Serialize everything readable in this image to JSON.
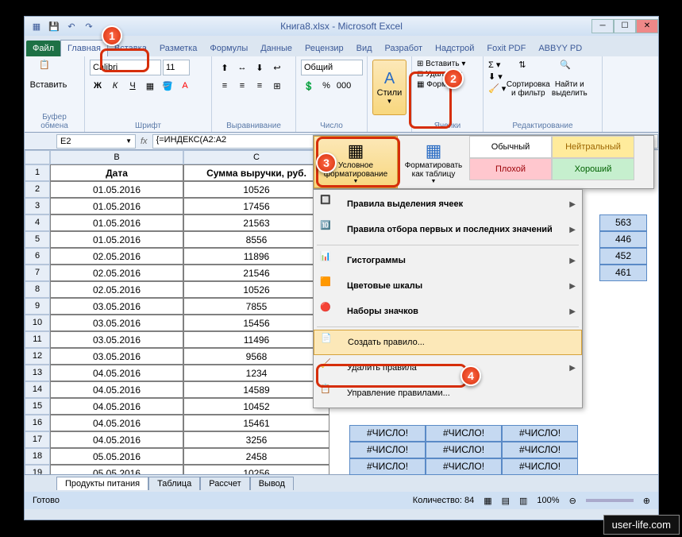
{
  "title": "Книга8.xlsx - Microsoft Excel",
  "tabs": {
    "file": "Файл",
    "home": "Главная",
    "insert": "Вставка",
    "layout": "Разметка",
    "formulas": "Формулы",
    "data": "Данные",
    "review": "Рецензир",
    "view": "Вид",
    "dev": "Разработ",
    "addins": "Надстрой",
    "foxit": "Foxit PDF",
    "abbyy": "ABBYY PD"
  },
  "ribbon": {
    "clipboard": {
      "label": "Буфер обмена",
      "paste": "Вставить"
    },
    "font": {
      "label": "Шрифт",
      "name": "Calibri",
      "size": "11"
    },
    "align": {
      "label": "Выравнивание"
    },
    "number": {
      "label": "Число",
      "format": "Общий"
    },
    "styles": {
      "label": "Стили",
      "cells_label": "Ячейки",
      "insert": "Вставить",
      "delete": "Удалить",
      "format": "Формат"
    },
    "editing": {
      "label": "Редактирование",
      "sort": "Сортировка\nи фильтр",
      "find": "Найти и\nвыделить"
    }
  },
  "namebox": "E2",
  "formula": "{=ИНДЕКС(A2:A2",
  "columns": {
    "b": "B",
    "c": "C"
  },
  "headers": {
    "date": "Дата",
    "revenue": "Сумма выручки, руб."
  },
  "rows": [
    {
      "n": "1"
    },
    {
      "n": "2",
      "d": "01.05.2016",
      "v": "10526"
    },
    {
      "n": "3",
      "d": "01.05.2016",
      "v": "17456"
    },
    {
      "n": "4",
      "d": "01.05.2016",
      "v": "21563"
    },
    {
      "n": "5",
      "d": "01.05.2016",
      "v": "8556"
    },
    {
      "n": "6",
      "d": "02.05.2016",
      "v": "11896"
    },
    {
      "n": "7",
      "d": "02.05.2016",
      "v": "21546"
    },
    {
      "n": "8",
      "d": "02.05.2016",
      "v": "10526"
    },
    {
      "n": "9",
      "d": "03.05.2016",
      "v": "7855"
    },
    {
      "n": "10",
      "d": "03.05.2016",
      "v": "15456"
    },
    {
      "n": "11",
      "d": "03.05.2016",
      "v": "11496"
    },
    {
      "n": "12",
      "d": "03.05.2016",
      "v": "9568"
    },
    {
      "n": "13",
      "d": "04.05.2016",
      "v": "1234"
    },
    {
      "n": "14",
      "d": "04.05.2016",
      "v": "14589"
    },
    {
      "n": "15",
      "d": "04.05.2016",
      "v": "10452"
    },
    {
      "n": "16",
      "d": "04.05.2016",
      "v": "15461"
    },
    {
      "n": "17",
      "d": "04.05.2016",
      "v": "3256"
    },
    {
      "n": "18",
      "d": "05.05.2016",
      "v": "2458"
    },
    {
      "n": "19",
      "d": "05.05.2016",
      "v": "10256"
    }
  ],
  "sheets": {
    "s1": "Продукты питания",
    "s2": "Таблица",
    "s3": "Рассчет",
    "s4": "Вывод"
  },
  "status": {
    "ready": "Готово",
    "count": "Количество: 84",
    "zoom": "100%"
  },
  "gallery": {
    "cf": "Условное\nформатирование",
    "fmt_table": "Форматировать\nкак таблицу",
    "normal": "Обычный",
    "neutral": "Нейтральный",
    "bad": "Плохой",
    "good": "Хороший",
    "vals": [
      "563",
      "446",
      "452",
      "461"
    ]
  },
  "cf_menu": {
    "highlight_cells": "Правила выделения ячеек",
    "top_bottom": "Правила отбора первых и последних значений",
    "data_bars": "Гистограммы",
    "color_scales": "Цветовые шкалы",
    "icon_sets": "Наборы значков",
    "new_rule": "Создать правило...",
    "clear": "Удалить правила",
    "manage": "Управление правилами..."
  },
  "err": "#ЧИСЛО!",
  "watermark": "user-life.com",
  "callouts": {
    "c1": "1",
    "c2": "2",
    "c3": "3",
    "c4": "4"
  }
}
